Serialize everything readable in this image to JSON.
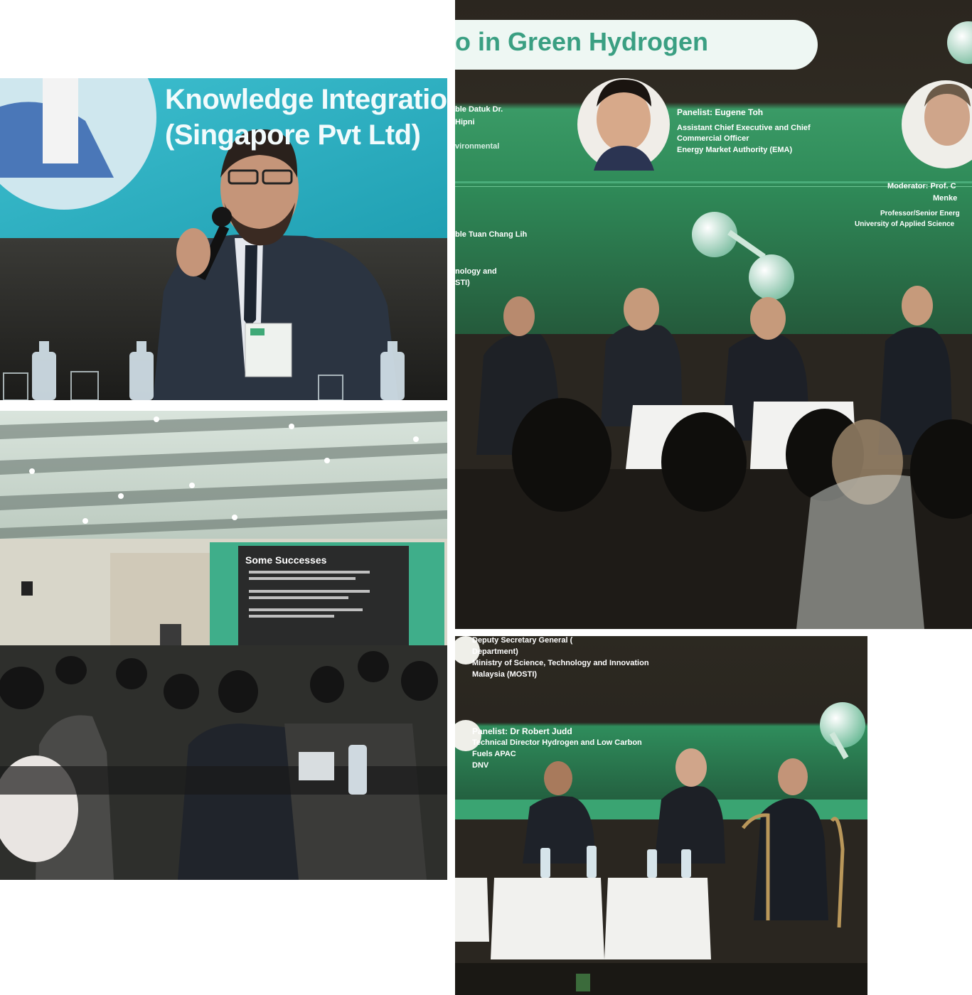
{
  "photo_top_left": {
    "slide_line1": "Knowledge Integration S",
    "slide_line2": "(Singapore Pvt Ltd)"
  },
  "photo_mid_left": {
    "slide_title": "Some Successes"
  },
  "photo_top_right": {
    "banner_title": "o in Green Hydrogen",
    "left_cut_lines": [
      "ble Datuk Dr.",
      "Hipni",
      "vironmental"
    ],
    "panelist_name": "Panelist: Eugene Toh",
    "panelist_role1": "Assistant Chief Executive and Chief",
    "panelist_role2": "Commercial Officer",
    "panelist_org": "Energy Market Authority (EMA)",
    "moderator_line1": "Moderator: Prof. C",
    "moderator_line2": "Menke",
    "moderator_line3": "Professor/Senior Energ",
    "moderator_line4": "University of Applied Science",
    "left_cut_lines2": [
      "ble Tuan Chang Lih",
      "nology and",
      "STI)"
    ]
  },
  "photo_bot_right": {
    "top_line1": "Deputy Secretary General (",
    "top_line2": "Department)",
    "top_line3": "Ministry of Science, Technology and Innovation",
    "top_line4": "Malaysia (MOSTI)",
    "panelist_name": "Panelist: Dr Robert Judd",
    "panelist_role1": "Technical Director Hydrogen and Low Carbon",
    "panelist_role2": "Fuels APAC",
    "panelist_org": "DNV"
  },
  "colors": {
    "teal_screen": "#2fb3c6",
    "green_screen": "#2f8f5f",
    "dark_stage": "#2a2620"
  }
}
